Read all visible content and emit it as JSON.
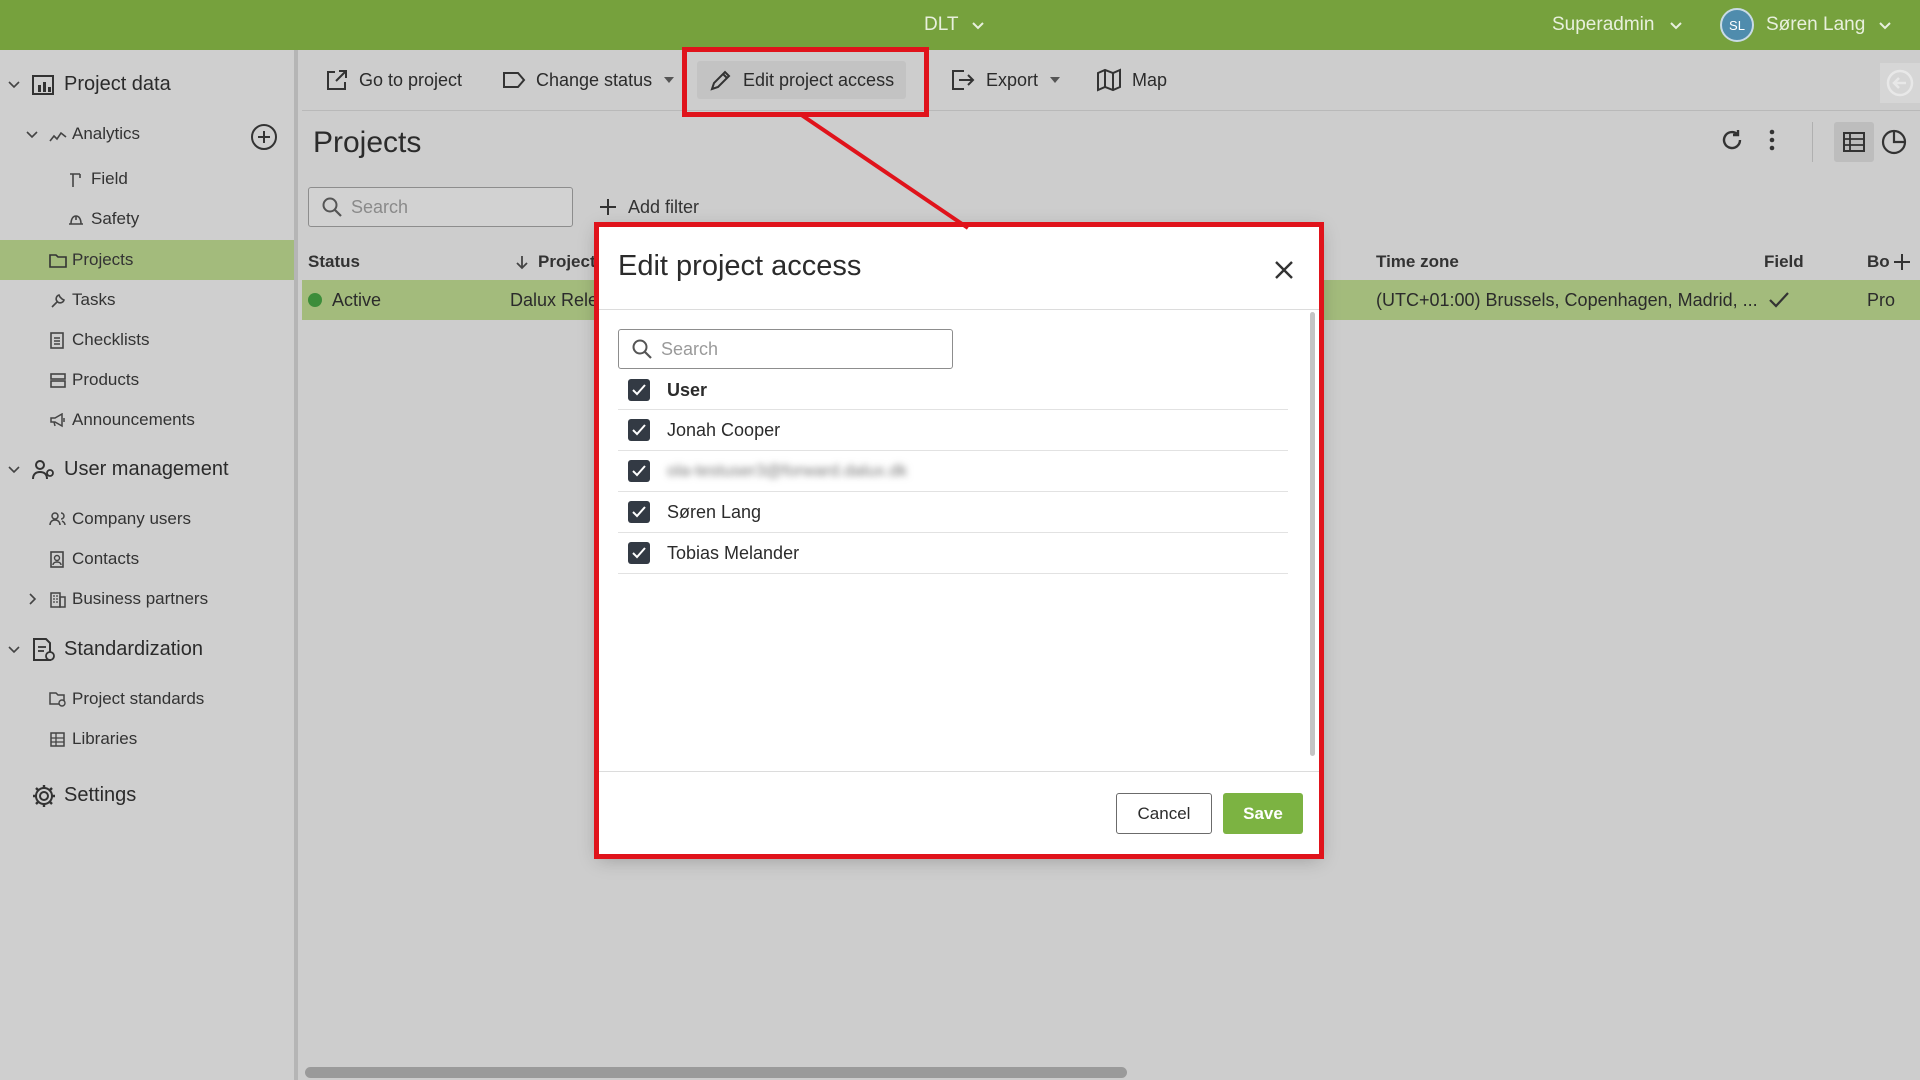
{
  "topbar": {
    "center_label": "DLT",
    "role_label": "Superadmin",
    "avatar_initials": "SL",
    "user_name": "Søren Lang",
    "color": "#76a13d"
  },
  "sidebar": {
    "sections": [
      {
        "label": "Project data",
        "icon": "project-data-icon"
      },
      {
        "label": "User management",
        "icon": "user-management-icon"
      },
      {
        "label": "Standardization",
        "icon": "standardization-icon"
      },
      {
        "label": "Settings",
        "icon": "gear-icon"
      }
    ],
    "items": [
      {
        "label": "Analytics",
        "icon": "analytics-icon"
      },
      {
        "label": "Field",
        "icon": "field-icon"
      },
      {
        "label": "Safety",
        "icon": "safety-icon"
      },
      {
        "label": "Projects",
        "icon": "folder-icon",
        "active": true
      },
      {
        "label": "Tasks",
        "icon": "wrench-icon"
      },
      {
        "label": "Checklists",
        "icon": "checklist-icon"
      },
      {
        "label": "Products",
        "icon": "products-icon"
      },
      {
        "label": "Announcements",
        "icon": "megaphone-icon"
      },
      {
        "label": "Company users",
        "icon": "users-icon"
      },
      {
        "label": "Contacts",
        "icon": "contacts-icon"
      },
      {
        "label": "Business partners",
        "icon": "building-icon"
      },
      {
        "label": "Project standards",
        "icon": "project-standards-icon"
      },
      {
        "label": "Libraries",
        "icon": "libraries-icon"
      }
    ]
  },
  "toolbar": {
    "go_to_project": "Go to project",
    "change_status": "Change status",
    "edit_project_access": "Edit project access",
    "export": "Export",
    "map": "Map"
  },
  "main": {
    "title": "Projects",
    "search_placeholder": "Search",
    "add_filter": "Add filter",
    "columns": [
      "Status",
      "Project",
      "Time zone",
      "Field",
      "Bo"
    ],
    "row": {
      "status": "Active",
      "project": "Dalux Rele",
      "time_zone": "(UTC+01:00) Brussels, Copenhagen, Madrid, ...",
      "field_checked": true,
      "bo": "Pro"
    }
  },
  "modal": {
    "title": "Edit project access",
    "search_placeholder": "Search",
    "header_label": "User",
    "users": [
      {
        "name": "Jonah Cooper",
        "checked": true
      },
      {
        "name": "ola-testuser3@forward.dalux.dk",
        "checked": true,
        "obscured": true
      },
      {
        "name": "Søren Lang",
        "checked": true
      },
      {
        "name": "Tobias Melander",
        "checked": true
      }
    ],
    "cancel_label": "Cancel",
    "save_label": "Save",
    "save_color": "#7cb342"
  },
  "annotation_color": "#e0131b"
}
